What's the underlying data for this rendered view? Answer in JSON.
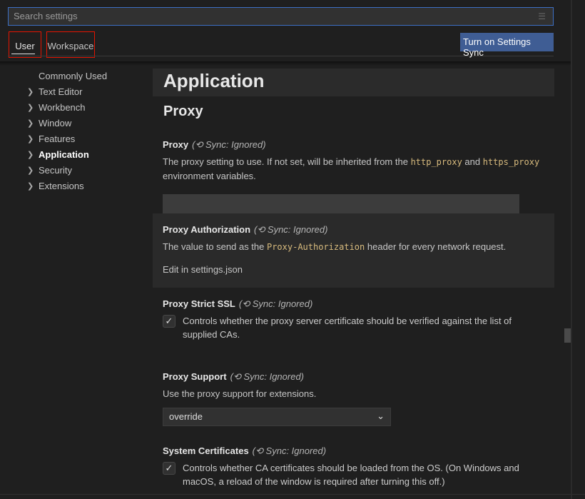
{
  "search": {
    "placeholder": "Search settings",
    "clear_icon": "clear-filter-icon"
  },
  "tabs": [
    {
      "label": "User",
      "active": true
    },
    {
      "label": "Workspace"
    }
  ],
  "sync_button": "Turn on Settings Sync",
  "nav": [
    {
      "label": "Commonly Used"
    },
    {
      "label": "Text Editor"
    },
    {
      "label": "Workbench"
    },
    {
      "label": "Window"
    },
    {
      "label": "Features"
    },
    {
      "label": "Application",
      "active": true
    },
    {
      "label": "Security"
    },
    {
      "label": "Extensions"
    }
  ],
  "main": {
    "section": "Application",
    "subsection": "Proxy",
    "sync_note": "Sync: Ignored",
    "proxy": {
      "title": "Proxy",
      "desc1": "The proxy setting to use. If not set, will be inherited from the ",
      "code1": "http_proxy",
      "and": " and ",
      "code2": "https_proxy",
      "desc2": " environment variables.",
      "value": ""
    },
    "auth": {
      "title": "Proxy Authorization",
      "desc1": "The value to send as the ",
      "code": "Proxy-Authorization",
      "desc2": " header for every network request.",
      "link": "Edit in settings.json"
    },
    "ssl": {
      "title": "Proxy Strict SSL",
      "desc": "Controls whether the proxy server certificate should be verified against the list of supplied CAs.",
      "checked": true
    },
    "support": {
      "title": "Proxy Support",
      "desc": "Use the proxy support for extensions.",
      "value": "override"
    },
    "certs": {
      "title": "System Certificates",
      "desc": "Controls whether CA certificates should be loaded from the OS. (On Windows and macOS, a reload of the window is required after turning this off.)",
      "checked": true
    }
  }
}
